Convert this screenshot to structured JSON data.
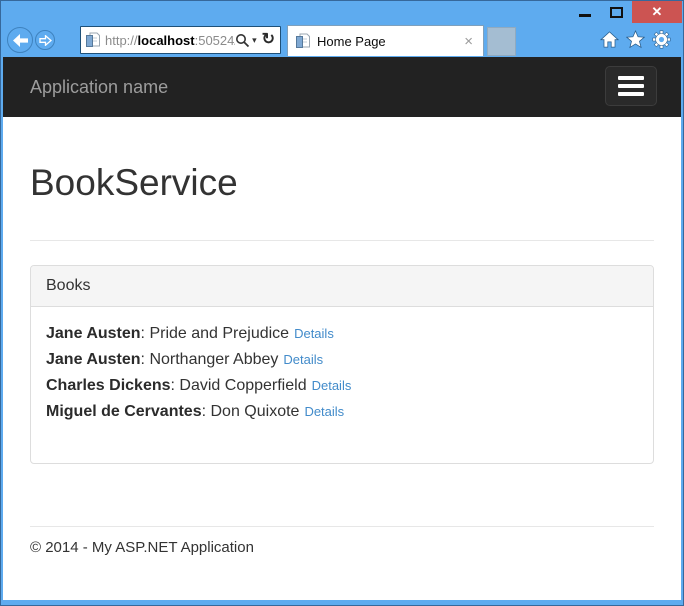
{
  "window": {
    "controls": {
      "minimize": "minimize",
      "maximize": "maximize",
      "close": "close"
    },
    "colors": {
      "chrome_blue": "#5EABEF",
      "close_red": "#CC5452",
      "navbar_bg": "#222222",
      "link_blue": "#428bca"
    }
  },
  "browser": {
    "url": {
      "protocol": "http://",
      "host": "localhost",
      "tail": ":50524/"
    },
    "tab": {
      "title": "Home Page"
    }
  },
  "icons": {
    "window_close_glyph": "✕",
    "tab_close_glyph": "×",
    "dropdown_caret_glyph": "▾",
    "refresh_glyph": "↻"
  },
  "navbar": {
    "brand": "Application name"
  },
  "main": {
    "heading": "BookService",
    "panel": {
      "title": "Books",
      "separator": ": ",
      "books": [
        {
          "author": "Jane Austen",
          "title": "Pride and Prejudice",
          "details": "Details"
        },
        {
          "author": "Jane Austen",
          "title": "Northanger Abbey",
          "details": "Details"
        },
        {
          "author": "Charles Dickens",
          "title": "David Copperfield",
          "details": "Details"
        },
        {
          "author": "Miguel de Cervantes",
          "title": "Don Quixote",
          "details": "Details"
        }
      ]
    }
  },
  "footer": {
    "copyright": "© 2014 - My ASP.NET Application"
  }
}
